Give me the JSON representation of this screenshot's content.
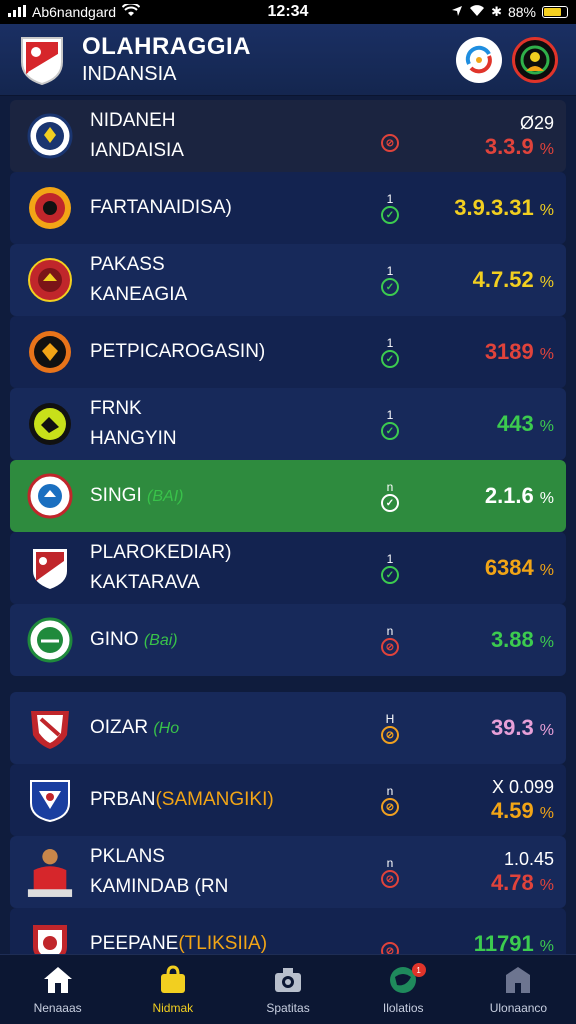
{
  "status_bar": {
    "carrier": "Ab6nandgard",
    "time": "12:34",
    "battery": "88%"
  },
  "header": {
    "title_line1": "OLAHRAGGIA",
    "title_line2": "INDANSIA"
  },
  "rows": [
    {
      "name1": "NIDANEH",
      "name2": "IANDAISIA",
      "mark": "",
      "status": "red",
      "value_top": "Ø29",
      "value": "3.3.9",
      "pct": "%",
      "value_color": "red",
      "style": "dark"
    },
    {
      "name1": "FARTANAIDISA)",
      "name2": "",
      "mark": "1",
      "status": "green",
      "value_top": "",
      "value": "3.9.3.31",
      "pct": "%",
      "value_color": "yellow",
      "style": "plain"
    },
    {
      "name1": "PAKASS",
      "name2": "KANEAGIA",
      "mark": "1",
      "status": "green",
      "value_top": "",
      "value": "4.7.52",
      "pct": "%",
      "value_color": "yellow",
      "style": "alt"
    },
    {
      "name1": "PETPICAROGASIN)",
      "name2": "",
      "mark": "1",
      "status": "green",
      "value_top": "",
      "value": "3189",
      "pct": "%",
      "value_color": "red",
      "style": "plain"
    },
    {
      "name1": "FRNK",
      "name2": "HANGYIN",
      "mark": "1",
      "status": "green",
      "value_top": "",
      "value": "443",
      "pct": "%",
      "value_color": "green",
      "style": "alt"
    },
    {
      "name1": "SINGI",
      "name1_sub": "(BAI)",
      "name2": "",
      "mark": "n",
      "status": "white",
      "value_top": "",
      "value": "2.1.6",
      "pct": "%",
      "value_color": "white",
      "style": "highlight"
    },
    {
      "name1": "PLAROKEDIAR)",
      "name2": "KAKTARAVA",
      "mark": "1",
      "status": "green",
      "value_top": "",
      "value": "6384",
      "pct": "%",
      "value_color": "orange",
      "style": "plain"
    },
    {
      "name1": "GINO",
      "name1_sub": "(Bai)",
      "name2": "",
      "mark": "n",
      "status": "red",
      "value_top": "",
      "value": "3.88",
      "pct": "%",
      "value_color": "green",
      "style": "alt"
    },
    {
      "name1": "OIZAR",
      "name1_sub": "(Ho",
      "name2": "",
      "mark": "H",
      "status": "orange",
      "value_top": "",
      "value": "39.3",
      "pct": "%",
      "value_color": "pink",
      "style": "alt"
    },
    {
      "name1": "PRBAN",
      "name1_sub_orange": "(SAMANGIKI)",
      "name2": "",
      "mark": "n",
      "status": "orange",
      "value_top": "X 0.099",
      "value": "4.59",
      "pct": "%",
      "value_color": "orange",
      "style": "plain"
    },
    {
      "name1": "PKLANS",
      "name2": "KAMINDAB",
      "name2_sub": "(RN",
      "mark": "n",
      "status": "red",
      "value_top": "1.0.45",
      "value": "4.78",
      "pct": "%",
      "value_color": "red",
      "style": "alt"
    },
    {
      "name1": "PEEPANE",
      "name1_sub_orange": "(TLIKSIIA)",
      "name2": "",
      "mark": "",
      "status": "red",
      "value_top": "",
      "value": "11791",
      "pct": "%",
      "value_color": "green",
      "style": "plain"
    }
  ],
  "nav": [
    {
      "label": "Nenaaas",
      "icon": "home-icon",
      "active": false
    },
    {
      "label": "Nidmak",
      "icon": "bag-icon",
      "active": true
    },
    {
      "label": "Spatitas",
      "icon": "camera-icon",
      "active": false
    },
    {
      "label": "Ilolatios",
      "icon": "globe-icon",
      "active": false,
      "badge": "1"
    },
    {
      "label": "Ulonaanco",
      "icon": "building-icon",
      "active": false
    }
  ]
}
